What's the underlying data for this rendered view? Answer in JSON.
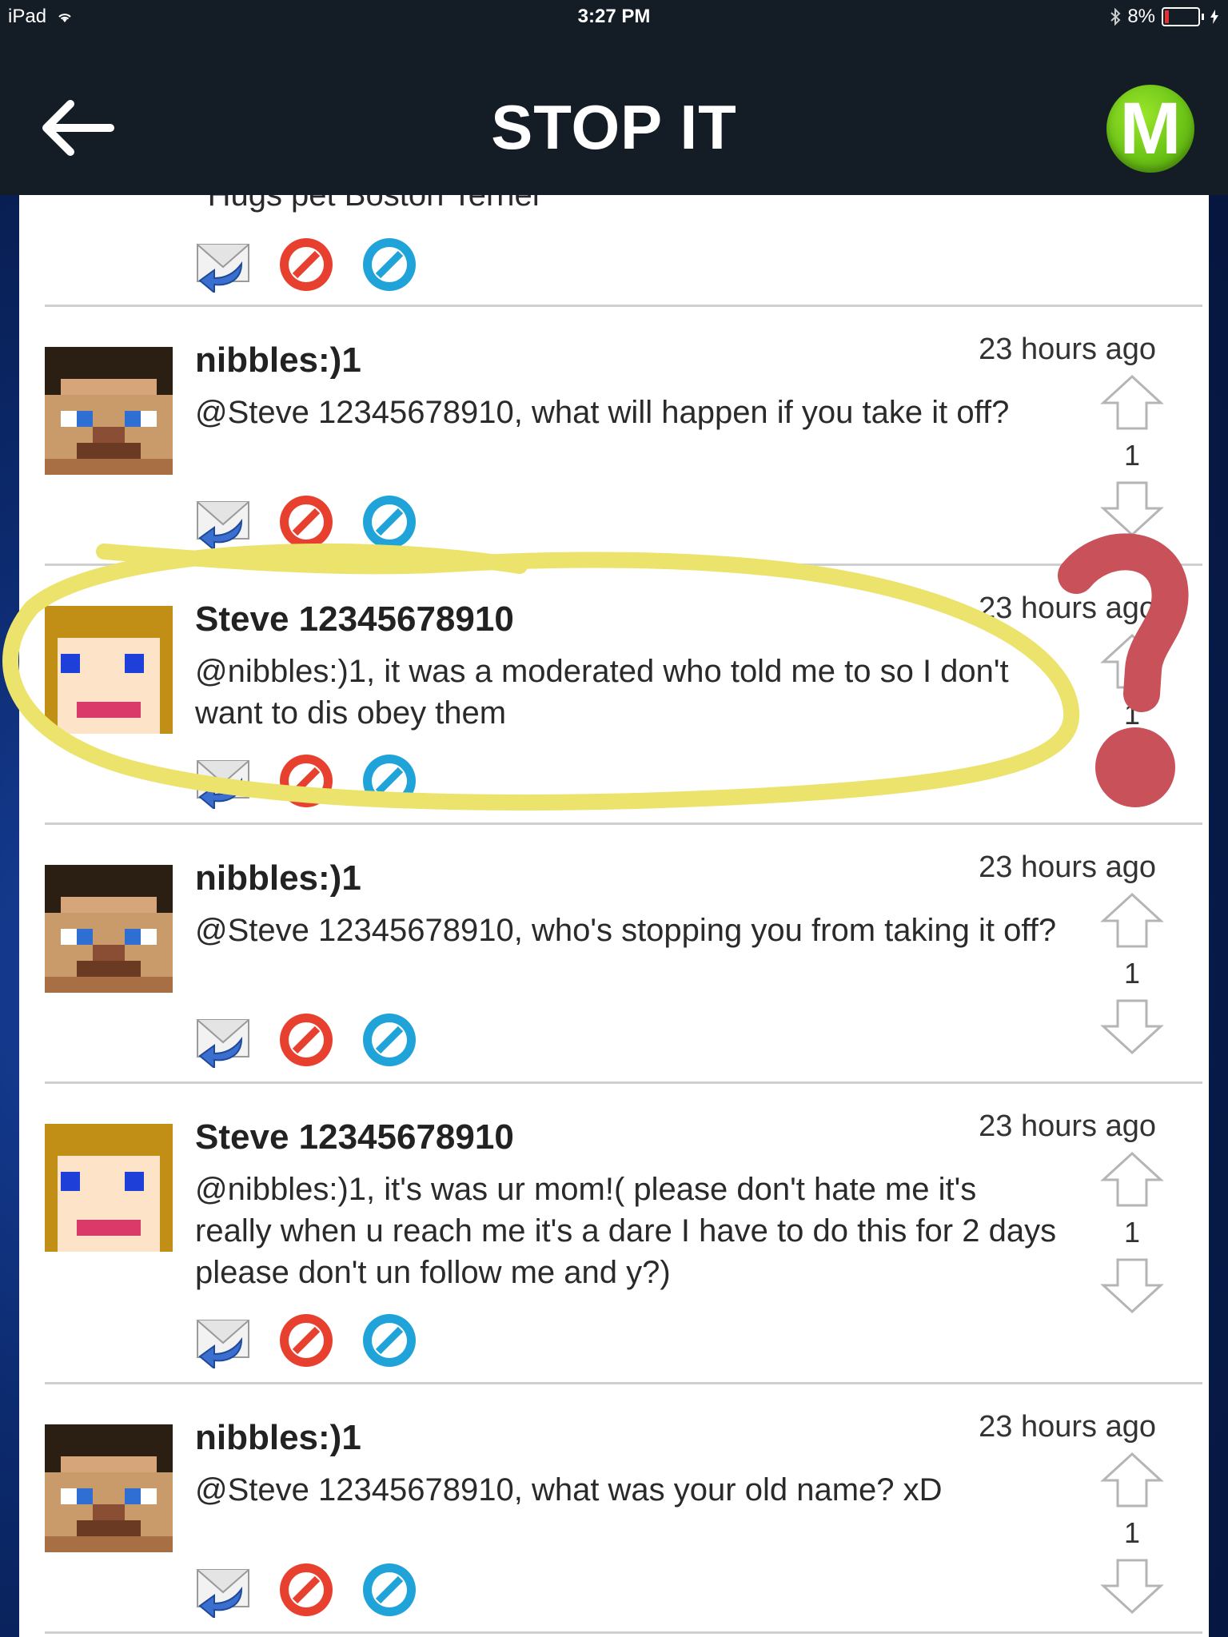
{
  "status_bar": {
    "device": "iPad",
    "time": "3:27 PM",
    "battery": "8%"
  },
  "header": {
    "title": "STOP IT",
    "logo_letter": "M"
  },
  "partial_post": {
    "message": "*Hugs pet Boston Terrier*"
  },
  "posts": [
    {
      "username": "nibbles:)1",
      "avatar": "steve-skin",
      "time": "23 hours ago",
      "message": "@Steve 12345678910, what will happen if you take it off?",
      "votes": "1"
    },
    {
      "username": "Steve 12345678910",
      "avatar": "alex-skin",
      "time": "23 hours ago",
      "message": "@nibbles:)1, it was a moderated who told me to so I don't want to dis obey them",
      "votes": "1"
    },
    {
      "username": "nibbles:)1",
      "avatar": "steve-skin",
      "time": "23 hours ago",
      "message": "@Steve 12345678910, who's stopping you from taking it off?",
      "votes": "1"
    },
    {
      "username": "Steve 12345678910",
      "avatar": "alex-skin",
      "time": "23 hours ago",
      "message": "@nibbles:)1, it's was ur mom!( please don't hate me it's really when u reach me it's a dare I have to do this for 2 days please don't un follow me and y?)",
      "votes": "1"
    },
    {
      "username": "nibbles:)1",
      "avatar": "steve-skin",
      "time": "23 hours ago",
      "message": "@Steve 12345678910, what was your old name? xD",
      "votes": "1"
    }
  ],
  "colors": {
    "header_bg": "#141c26",
    "logo_green": "#6cc416",
    "highlight_yellow": "#ebe36b",
    "question_red": "#c8515a",
    "block_red": "#e8402f",
    "cancel_blue": "#1fa3d8"
  }
}
